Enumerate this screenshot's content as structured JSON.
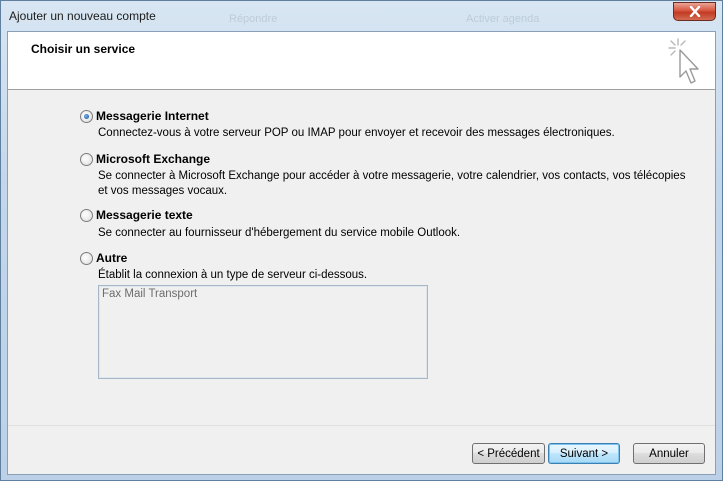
{
  "window": {
    "title": "Ajouter un nouveau compte",
    "ghost_texts": [
      "Répondre",
      "Activer agenda"
    ]
  },
  "header": {
    "title": "Choisir un service"
  },
  "options": [
    {
      "label": "Messagerie Internet",
      "description": "Connectez-vous à votre serveur POP ou IMAP pour envoyer et recevoir des messages électroniques.",
      "checked": true
    },
    {
      "label": "Microsoft Exchange",
      "description": "Se connecter à Microsoft Exchange pour accéder à votre messagerie, votre calendrier, vos contacts, vos télécopies et vos messages vocaux.",
      "checked": false
    },
    {
      "label": "Messagerie texte",
      "description": "Se connecter au fournisseur d'hébergement du service mobile Outlook.",
      "checked": false
    },
    {
      "label": "Autre",
      "description": "Établit la connexion à un type de serveur ci-dessous.",
      "checked": false
    }
  ],
  "other_servers": [
    "Fax Mail Transport"
  ],
  "buttons": {
    "previous": "< Précédent",
    "next": "Suivant >",
    "cancel": "Annuler"
  },
  "colors": {
    "accent_radio": "#1b5ea8",
    "close_button": "#c23b22"
  }
}
